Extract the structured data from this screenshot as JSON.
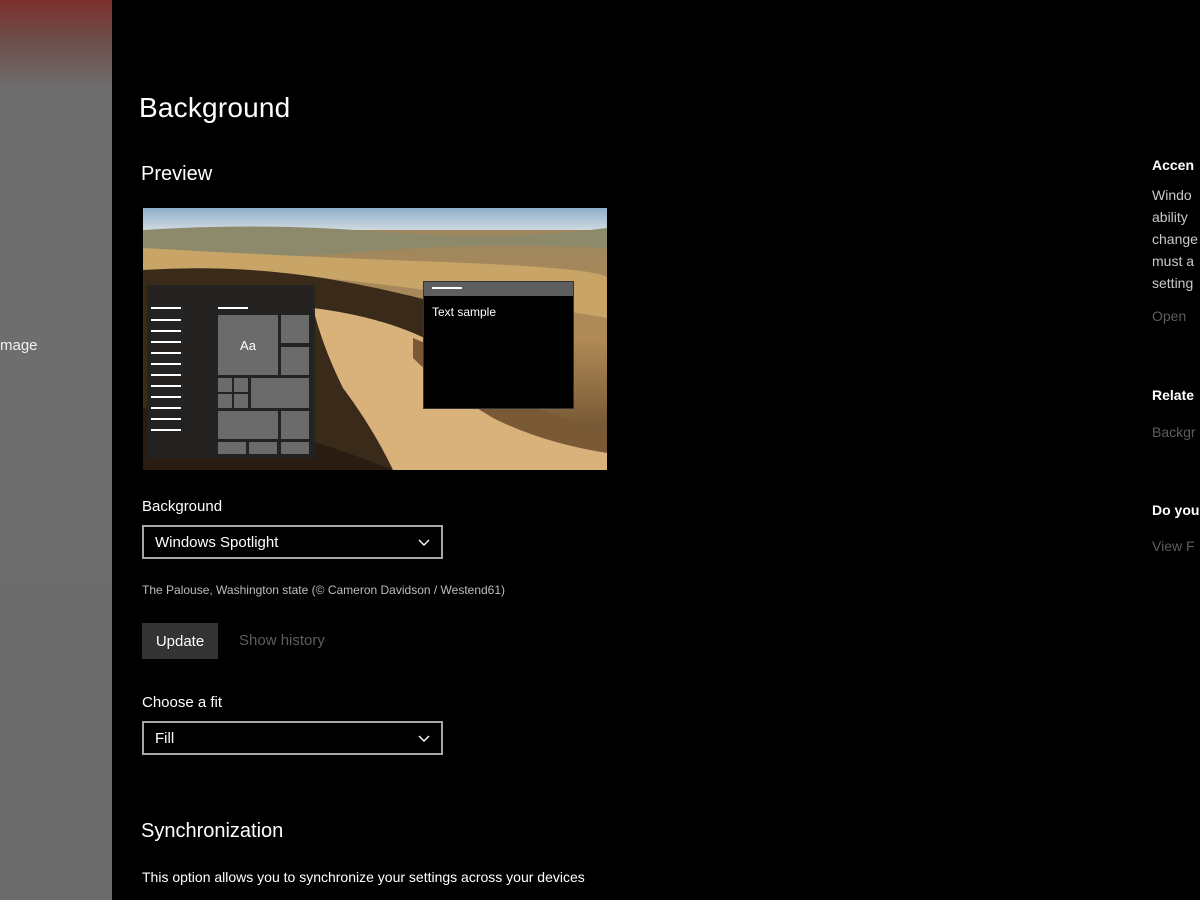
{
  "sidebar": {
    "item_label": "mage"
  },
  "page": {
    "title": "Background"
  },
  "preview": {
    "section_title": "Preview",
    "start_tile_label": "Aa",
    "window_text": "Text sample"
  },
  "background": {
    "label": "Background",
    "selected": "Windows Spotlight",
    "image_caption": "The Palouse, Washington state (© Cameron Davidson / Westend61)",
    "update_button": "Update",
    "history_link": "Show history"
  },
  "fit": {
    "label": "Choose a fit",
    "selected": "Fill"
  },
  "sync": {
    "title": "Synchronization",
    "description": "This option allows you to synchronize your settings across your devices"
  },
  "right_panel": {
    "accent_heading": "Accen",
    "accent_lines": [
      "Windo",
      "ability",
      "change",
      "must a",
      "setting"
    ],
    "accent_link": "Open",
    "related_heading": "Relate",
    "related_link": "Backgr",
    "question_heading": "Do you",
    "question_link": "View F"
  },
  "colors": {
    "background": "#000000",
    "sidebar": "#6e6e6e",
    "dropdown_border": "#a6a6a6",
    "button": "#333333",
    "disabled_link": "#5d5d5d"
  }
}
